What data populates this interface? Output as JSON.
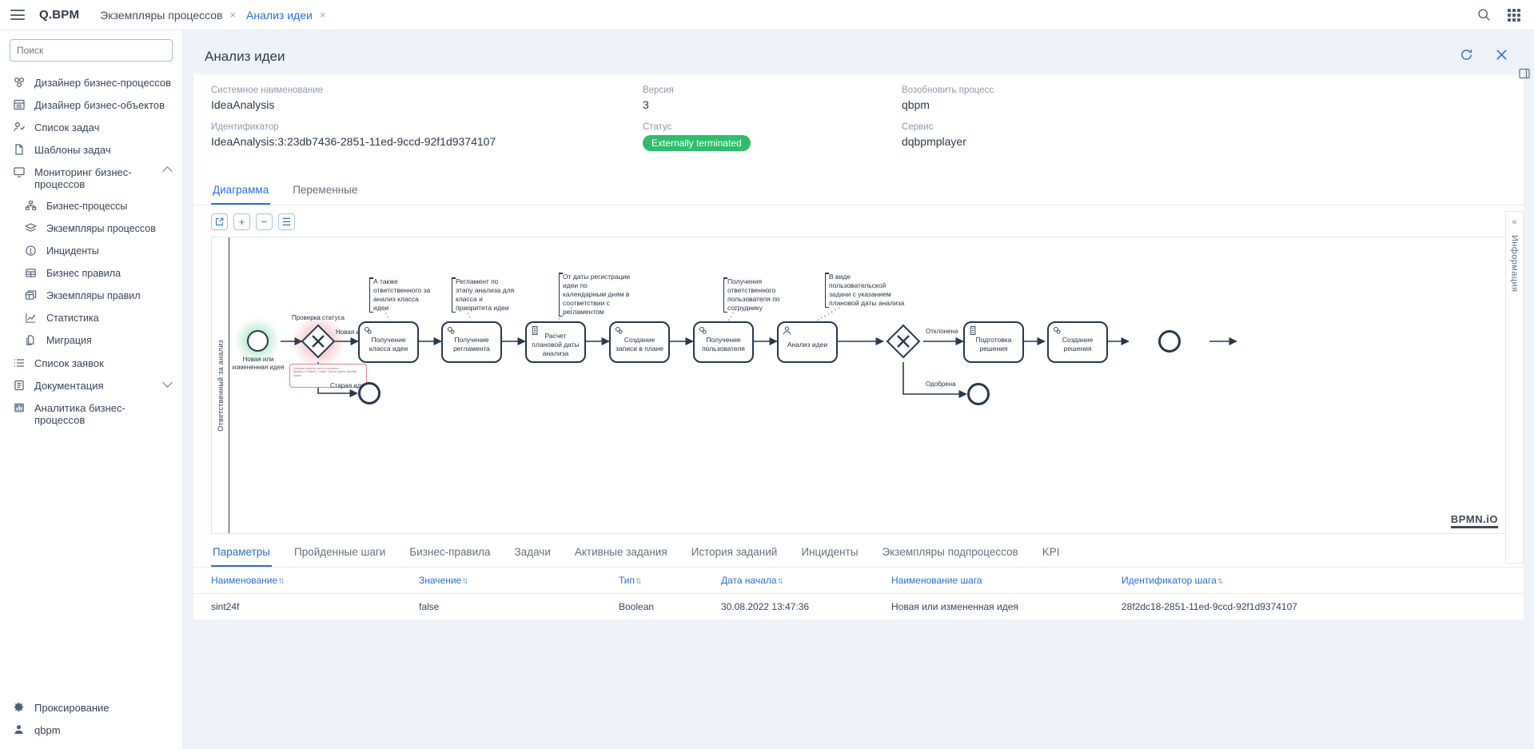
{
  "topbar": {
    "menu_icon": "hamburger-icon",
    "brand": "Q.BPM",
    "tabs": [
      {
        "label": "Экземпляры процессов",
        "close": "×",
        "active": false
      },
      {
        "label": "Анализ идеи",
        "close": "×",
        "active": true
      }
    ],
    "search_icon": "search-icon",
    "apps_icon": "grid-apps-icon"
  },
  "sidebar": {
    "search_placeholder": "Поиск",
    "items": [
      {
        "label": "Дизайнер бизнес-процессов",
        "icon": "process-designer-icon",
        "sub": false
      },
      {
        "label": "Дизайнер бизнес-объектов",
        "icon": "object-designer-icon",
        "sub": false
      },
      {
        "label": "Список задач",
        "icon": "task-list-icon",
        "sub": false
      },
      {
        "label": "Шаблоны задач",
        "icon": "task-templates-icon",
        "sub": false
      },
      {
        "label": "Мониторинг бизнес-процессов",
        "icon": "monitor-icon",
        "sub": false,
        "expanded": true
      },
      {
        "label": "Бизнес-процессы",
        "icon": "org-tree-icon",
        "sub": true
      },
      {
        "label": "Экземпляры процессов",
        "icon": "layers-icon",
        "sub": true
      },
      {
        "label": "Инциденты",
        "icon": "alert-circle-icon",
        "sub": true
      },
      {
        "label": "Бизнес правила",
        "icon": "table-icon",
        "sub": true
      },
      {
        "label": "Экземпляры правил",
        "icon": "rules-instances-icon",
        "sub": true
      },
      {
        "label": "Статистика",
        "icon": "chart-line-icon",
        "sub": true
      },
      {
        "label": "Миграция",
        "icon": "migration-icon",
        "sub": true
      },
      {
        "label": "Список заявок",
        "icon": "list-icon",
        "sub": false
      },
      {
        "label": "Документация",
        "icon": "book-icon",
        "sub": false,
        "collapsed": true
      },
      {
        "label": "Аналитика бизнес-процессов",
        "icon": "bar-chart-icon",
        "sub": false
      }
    ],
    "bottom_items": [
      {
        "label": "Проксирование",
        "icon": "gear-icon"
      },
      {
        "label": "qbpm",
        "icon": "user-icon"
      }
    ]
  },
  "page": {
    "title": "Анализ идеи",
    "refresh_icon": "refresh-icon",
    "close_icon": "close-icon"
  },
  "info": {
    "fields": [
      {
        "label": "Системное наименование",
        "value": "IdeaAnalysis"
      },
      {
        "label": "Идентификатор",
        "value": "IdeaAnalysis:3:23db7436-2851-11ed-9ccd-92f1d9374107"
      },
      {
        "label": "Версия",
        "value": "3"
      },
      {
        "label": "Статус",
        "value": "Externally terminated",
        "badge": true,
        "badge_color": "#2ebd6b"
      },
      {
        "label": "Возобновить процесс",
        "value": "qbpm"
      },
      {
        "label": "Сервис",
        "value": "dqbpmplayer"
      }
    ]
  },
  "content_tabs": [
    {
      "label": "Диаграмма",
      "active": true
    },
    {
      "label": "Переменные",
      "active": false
    }
  ],
  "diagram": {
    "zoom_tools": [
      {
        "name": "open-external-button",
        "glyph": "↗"
      },
      {
        "name": "zoom-in-button",
        "glyph": "+"
      },
      {
        "name": "zoom-out-button",
        "glyph": "−"
      },
      {
        "name": "fit-viewport-button",
        "glyph": "☰"
      }
    ],
    "lane_label": "Ответственный за анализ",
    "watermark": "BPMN.iO",
    "nodes": [
      {
        "id": "start",
        "type": "start-event",
        "label": "Новая или измененная идея",
        "highlight": "green"
      },
      {
        "id": "gw1",
        "type": "exclusive-gateway",
        "label": "Проверка статуса",
        "highlight": "red"
      },
      {
        "id": "t1",
        "type": "service-task",
        "label": "Получение класса идеи"
      },
      {
        "id": "t2",
        "type": "service-task",
        "label": "Получение регламента"
      },
      {
        "id": "t3",
        "type": "script-task",
        "label": "Расчет плановой даты анализа"
      },
      {
        "id": "t4",
        "type": "service-task",
        "label": "Создание записи в плане"
      },
      {
        "id": "t5",
        "type": "service-task",
        "label": "Получение пользователя"
      },
      {
        "id": "t6",
        "type": "user-task",
        "label": "Анализ идеи"
      },
      {
        "id": "gw2",
        "type": "exclusive-gateway",
        "label": ""
      },
      {
        "id": "t7",
        "type": "script-task",
        "label": "Подготовка решения"
      },
      {
        "id": "t8",
        "type": "service-task",
        "label": "Создание решения"
      },
      {
        "id": "end1",
        "type": "end-event",
        "label": ""
      },
      {
        "id": "end2",
        "type": "end-event",
        "label": ""
      },
      {
        "id": "end3",
        "type": "end-event",
        "label": ""
      }
    ],
    "flow_labels": [
      {
        "text": "Новая идея"
      },
      {
        "text": "Старая идея"
      },
      {
        "text": "Отклонена"
      },
      {
        "text": "Одобрена"
      }
    ],
    "annotations": [
      {
        "text": "А также ответственного за анализ класса идеи"
      },
      {
        "text": "Регламент по этапу анализа для класса и приоритета идеи"
      },
      {
        "text": "От даты регистрации идеи по календарным дням в соответствии с регламентом"
      },
      {
        "text": "Получения ответственного пользователя по сотруднику"
      },
      {
        "text": "В виде пользовательской задачи с указанием плановой даты анализа"
      }
    ],
    "error_tooltip": "Unknown property used in expression: ${status==\"Новая\"}. Cause: Cannot resolve identifier 'status'"
  },
  "bottom": {
    "tabs": [
      {
        "label": "Параметры",
        "active": true
      },
      {
        "label": "Пройденные шаги",
        "active": false
      },
      {
        "label": "Бизнес-правила",
        "active": false
      },
      {
        "label": "Задачи",
        "active": false
      },
      {
        "label": "Активные задания",
        "active": false
      },
      {
        "label": "История заданий",
        "active": false
      },
      {
        "label": "Инциденты",
        "active": false
      },
      {
        "label": "Экземпляры подпроцессов",
        "active": false
      },
      {
        "label": "KPI",
        "active": false
      }
    ],
    "columns": [
      {
        "label": "Наименование",
        "sortable": true
      },
      {
        "label": "Значение",
        "sortable": true
      },
      {
        "label": "Тип",
        "sortable": true
      },
      {
        "label": "Дата начала",
        "sortable": true
      },
      {
        "label": "Наименование шага",
        "sortable": false
      },
      {
        "label": "Идентификатор шага",
        "sortable": true
      }
    ],
    "rows": [
      {
        "name": "sint24f",
        "value": "false",
        "type": "Boolean",
        "start_date": "30.08.2022 13:47:36",
        "step_name": "Новая или измененная идея",
        "step_id": "28f2dc18-2851-11ed-9ccd-92f1d9374107"
      }
    ]
  },
  "right_rail": {
    "collapse_glyph": "«",
    "label": "Информация",
    "float_icon": "panel-toggle-icon"
  }
}
